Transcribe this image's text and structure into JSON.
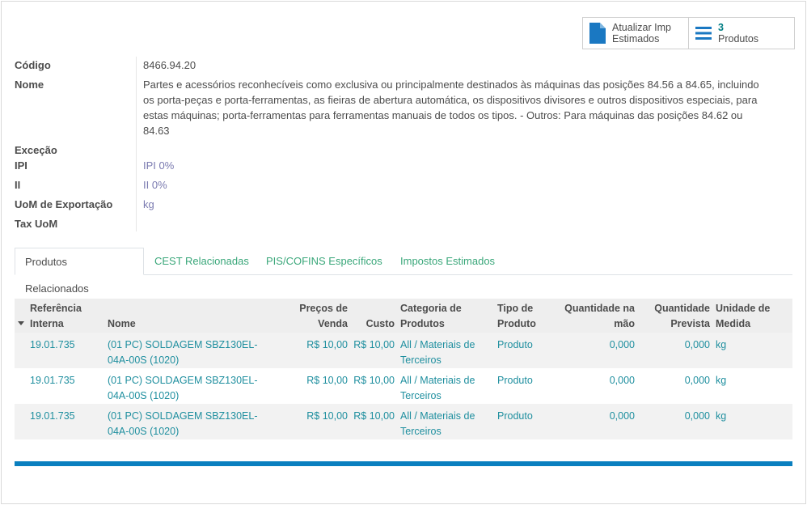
{
  "smart_buttons": {
    "update_label_line1": "Atualizar Imp",
    "update_label_line2": "Estimados",
    "products_count": "3",
    "products_label": "Produtos"
  },
  "fields": {
    "codigo_label": "Código",
    "codigo_value": "8466.94.20",
    "nome_label": "Nome",
    "nome_line1": "Partes e acessórios reconhecíveis como exclusiva ou principalmente destinados às máquinas das posições 84.56 a 84.65, incluindo",
    "nome_line2": "os porta-peças e porta-ferramentas, as fieiras de abertura automática, os dispositivos divisores e outros dispositivos especiais, para",
    "nome_line3": "estas máquinas; porta-ferramentas para ferramentas manuais de todos os tipos. - Outros: Para máquinas das posições 84.62 ou",
    "nome_line4": "84.63",
    "excecao_label": "Exceção",
    "ipi_label": "IPI",
    "ipi_value": "IPI 0%",
    "ii_label": "II",
    "ii_value": "II 0%",
    "uom_label": "UoM de Exportação",
    "uom_value": "kg",
    "tax_uom_label": "Tax UoM"
  },
  "tabs": [
    {
      "label": "Produtos Relacionados"
    },
    {
      "label": "CEST Relacionadas"
    },
    {
      "label": "PIS/COFINS Específicos"
    },
    {
      "label": "Impostos Estimados"
    }
  ],
  "table": {
    "headers": {
      "ref_1": "Referência",
      "ref_2": "Interna",
      "nome": "Nome",
      "preco_1": "Preços de",
      "preco_2": "Venda",
      "custo": "Custo",
      "cat_1": "Categoria de",
      "cat_2": "Produtos",
      "tipo_1": "Tipo de",
      "tipo_2": "Produto",
      "qmao_1": "Quantidade na",
      "qmao_2": "mão",
      "qprev_1": "Quantidade",
      "qprev_2": "Prevista",
      "unid_1": "Unidade de",
      "unid_2": "Medida"
    },
    "rows": [
      {
        "ref": "19.01.735",
        "nome_1": "(01 PC) SOLDAGEM SBZ130EL-",
        "nome_2": "04A-00S (1020)",
        "preco": "R$ 10,00",
        "custo": "R$ 10,00",
        "cat_1": "All / Materiais de",
        "cat_2": "Terceiros",
        "tipo": "Produto",
        "qmao": "0,000",
        "qprev": "0,000",
        "unid": "kg"
      },
      {
        "ref": "19.01.735",
        "nome_1": "(01 PC) SOLDAGEM SBZ130EL-",
        "nome_2": "04A-00S (1020)",
        "preco": "R$ 10,00",
        "custo": "R$ 10,00",
        "cat_1": "All / Materiais de",
        "cat_2": "Terceiros",
        "tipo": "Produto",
        "qmao": "0,000",
        "qprev": "0,000",
        "unid": "kg"
      },
      {
        "ref": "19.01.735",
        "nome_1": "(01 PC) SOLDAGEM SBZ130EL-",
        "nome_2": "04A-00S (1020)",
        "preco": "R$ 10,00",
        "custo": "R$ 10,00",
        "cat_1": "All / Materiais de",
        "cat_2": "Terceiros",
        "tipo": "Produto",
        "qmao": "0,000",
        "qprev": "0,000",
        "unid": "kg"
      }
    ]
  },
  "colors": {
    "link": "#1f8f9f",
    "tab_link": "#3aa77a",
    "bottom_bar": "#0a7fbf",
    "icon": "#1a78c2"
  }
}
